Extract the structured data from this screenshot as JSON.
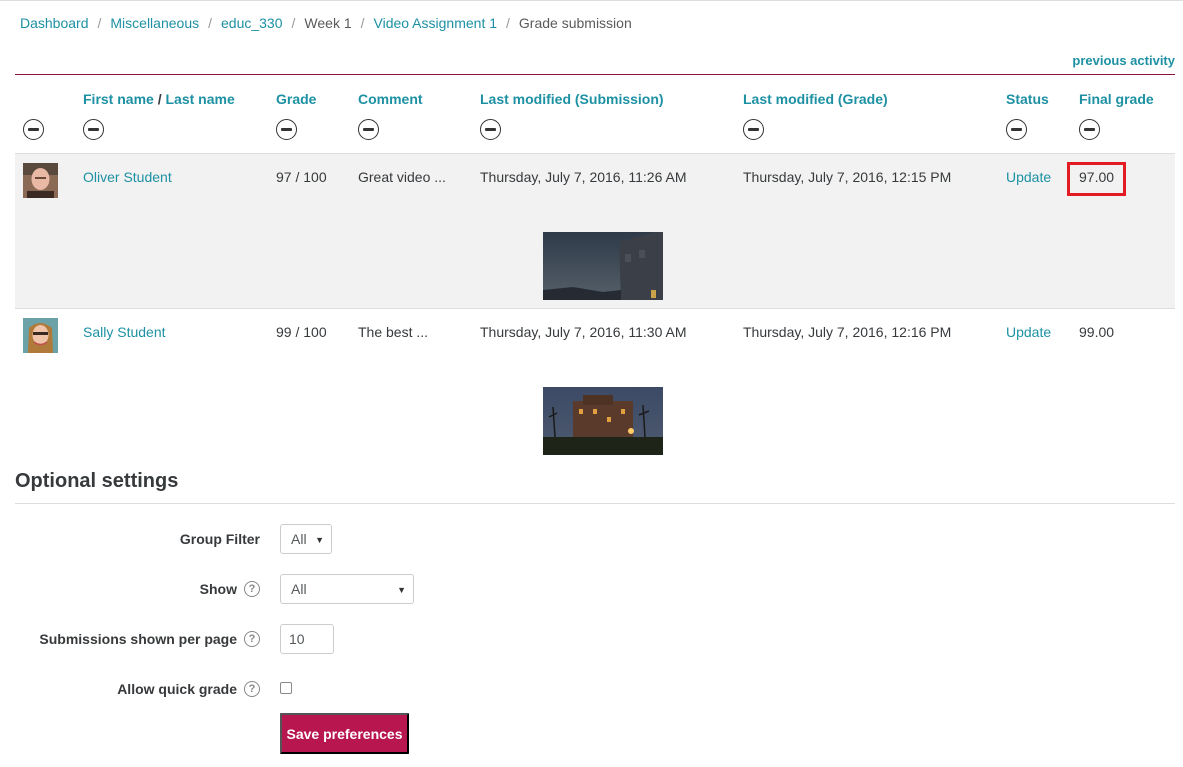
{
  "breadcrumb": [
    {
      "label": "Dashboard",
      "link": true
    },
    {
      "label": "Miscellaneous",
      "link": true
    },
    {
      "label": "educ_330",
      "link": true
    },
    {
      "label": "Week 1",
      "link": false
    },
    {
      "label": "Video Assignment 1",
      "link": true
    },
    {
      "label": "Grade submission",
      "link": false
    }
  ],
  "previous_activity": "previous activity",
  "table": {
    "headers": {
      "first_name": "First name",
      "slash": "/",
      "last_name": "Last name",
      "grade": "Grade",
      "comment": "Comment",
      "last_modified_submission": "Last modified (Submission)",
      "last_modified_grade": "Last modified (Grade)",
      "status": "Status",
      "final_grade": "Final grade"
    },
    "rows": [
      {
        "name": "Oliver Student",
        "grade": "97 / 100",
        "comment": "Great video ...",
        "modified_submission": "Thursday, July 7, 2016, 11:26 AM",
        "modified_grade": "Thursday, July 7, 2016, 12:15 PM",
        "status": "Update",
        "final_grade": "97.00"
      },
      {
        "name": "Sally Student",
        "grade": "99 / 100",
        "comment": "The best ...",
        "modified_submission": "Thursday, July 7, 2016, 11:30 AM",
        "modified_grade": "Thursday, July 7, 2016, 12:16 PM",
        "status": "Update",
        "final_grade": "99.00"
      }
    ]
  },
  "optional_settings": {
    "title": "Optional settings",
    "group_filter_label": "Group Filter",
    "group_filter_value": "All",
    "show_label": "Show",
    "show_value": "All",
    "per_page_label": "Submissions shown per page",
    "per_page_value": "10",
    "quick_grade_label": "Allow quick grade",
    "quick_grade_checked": false,
    "save_label": "Save preferences"
  },
  "colors": {
    "link": "#1d91a3",
    "accent": "#b8164e",
    "highlight": "#e31b23",
    "header_rule": "#8a1538"
  },
  "icons": [
    "hide-column-icon",
    "help-icon",
    "caret-down-icon"
  ]
}
